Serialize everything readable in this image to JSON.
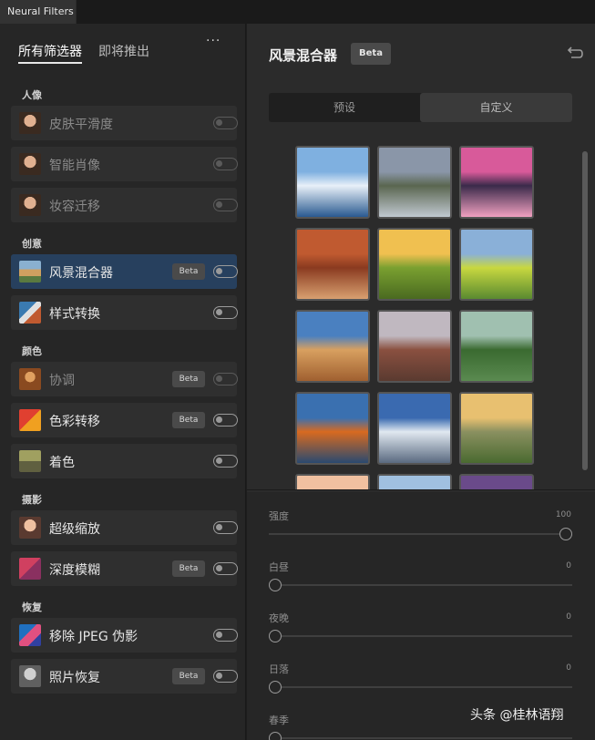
{
  "window": {
    "tab_title": "Neural Filters"
  },
  "left_panel": {
    "tabs": [
      {
        "label": "所有筛选器",
        "active": true
      },
      {
        "label": "即将推出",
        "active": false
      }
    ],
    "more_icon": "ellipsis-icon",
    "sections": [
      {
        "label": "人像",
        "items": [
          {
            "label": "皮肤平滑度",
            "beta": false,
            "disabled": true,
            "icon": "portrait-thumb"
          },
          {
            "label": "智能肖像",
            "beta": false,
            "disabled": true,
            "icon": "portrait-thumb"
          },
          {
            "label": "妆容迁移",
            "beta": false,
            "disabled": true,
            "icon": "portrait-thumb"
          }
        ]
      },
      {
        "label": "创意",
        "items": [
          {
            "label": "风景混合器",
            "beta": true,
            "disabled": false,
            "selected": true,
            "icon": "landscape-thumb"
          },
          {
            "label": "样式转换",
            "beta": false,
            "disabled": false,
            "icon": "style-thumb"
          }
        ]
      },
      {
        "label": "颜色",
        "items": [
          {
            "label": "协调",
            "beta": true,
            "disabled": true,
            "icon": "harmony-thumb"
          },
          {
            "label": "色彩转移",
            "beta": true,
            "disabled": false,
            "icon": "color-thumb"
          },
          {
            "label": "着色",
            "beta": false,
            "disabled": false,
            "icon": "colorize-thumb"
          }
        ]
      },
      {
        "label": "摄影",
        "items": [
          {
            "label": "超级缩放",
            "beta": false,
            "disabled": false,
            "icon": "zoom-thumb"
          },
          {
            "label": "深度模糊",
            "beta": true,
            "disabled": false,
            "icon": "blur-thumb"
          }
        ]
      },
      {
        "label": "恢复",
        "items": [
          {
            "label": "移除 JPEG 伪影",
            "beta": false,
            "disabled": false,
            "icon": "jpeg-thumb"
          },
          {
            "label": "照片恢复",
            "beta": true,
            "disabled": false,
            "icon": "restore-thumb"
          }
        ]
      }
    ],
    "beta_label": "Beta"
  },
  "right_panel": {
    "title": "风景混合器",
    "badge": "Beta",
    "reset_icon": "reset-icon",
    "segments": [
      {
        "label": "预设"
      },
      {
        "label": "自定义"
      }
    ],
    "presets": [
      {
        "name": "snow-lake",
        "colors": [
          "#7fb0e0",
          "#e8f0f8",
          "#2a5a90"
        ]
      },
      {
        "name": "mountain-valley",
        "colors": [
          "#8a96a8",
          "#5a6650",
          "#c0c8d0"
        ]
      },
      {
        "name": "pink-sunset",
        "colors": [
          "#d85a9a",
          "#3a2a4a",
          "#f0a0c0"
        ]
      },
      {
        "name": "canyon",
        "colors": [
          "#c05a30",
          "#8a3a20",
          "#d8a070"
        ]
      },
      {
        "name": "sunrise-hill",
        "colors": [
          "#f0c050",
          "#7aa030",
          "#4a6a20"
        ]
      },
      {
        "name": "green-meadow",
        "colors": [
          "#8ab0d8",
          "#c8d840",
          "#5a8a30"
        ]
      },
      {
        "name": "desert-rocks",
        "colors": [
          "#4a80c0",
          "#d8a060",
          "#a06030"
        ]
      },
      {
        "name": "monument-valley",
        "colors": [
          "#c0b8c0",
          "#8a5040",
          "#5a3a30"
        ]
      },
      {
        "name": "river-valley",
        "colors": [
          "#a0c0b0",
          "#3a6a30",
          "#5a8a50"
        ]
      },
      {
        "name": "autumn-lake",
        "colors": [
          "#3a70b0",
          "#d86a20",
          "#2a4a70"
        ]
      },
      {
        "name": "snow-peak",
        "colors": [
          "#3a6ab0",
          "#e0e8f0",
          "#5a6a80"
        ]
      },
      {
        "name": "yosemite",
        "colors": [
          "#e8c070",
          "#8a9060",
          "#4a6a30"
        ]
      },
      {
        "name": "row5-a",
        "colors": [
          "#f0c0a0",
          "#d08060",
          "#a06040"
        ]
      },
      {
        "name": "row5-b",
        "colors": [
          "#a0c0e0",
          "#e0e8f0",
          "#6080a0"
        ]
      },
      {
        "name": "row5-c",
        "colors": [
          "#6a4a8a",
          "#c06080",
          "#3a2a4a"
        ]
      }
    ],
    "sliders": [
      {
        "label": "强度",
        "value": "100",
        "fraction": 1.0
      },
      {
        "label": "白昼",
        "value": "0",
        "fraction": 0
      },
      {
        "label": "夜晚",
        "value": "0",
        "fraction": 0
      },
      {
        "label": "日落",
        "value": "0",
        "fraction": 0
      },
      {
        "label": "春季",
        "value": "",
        "fraction": 0
      }
    ]
  },
  "watermark": "头条 @桂林语翔"
}
